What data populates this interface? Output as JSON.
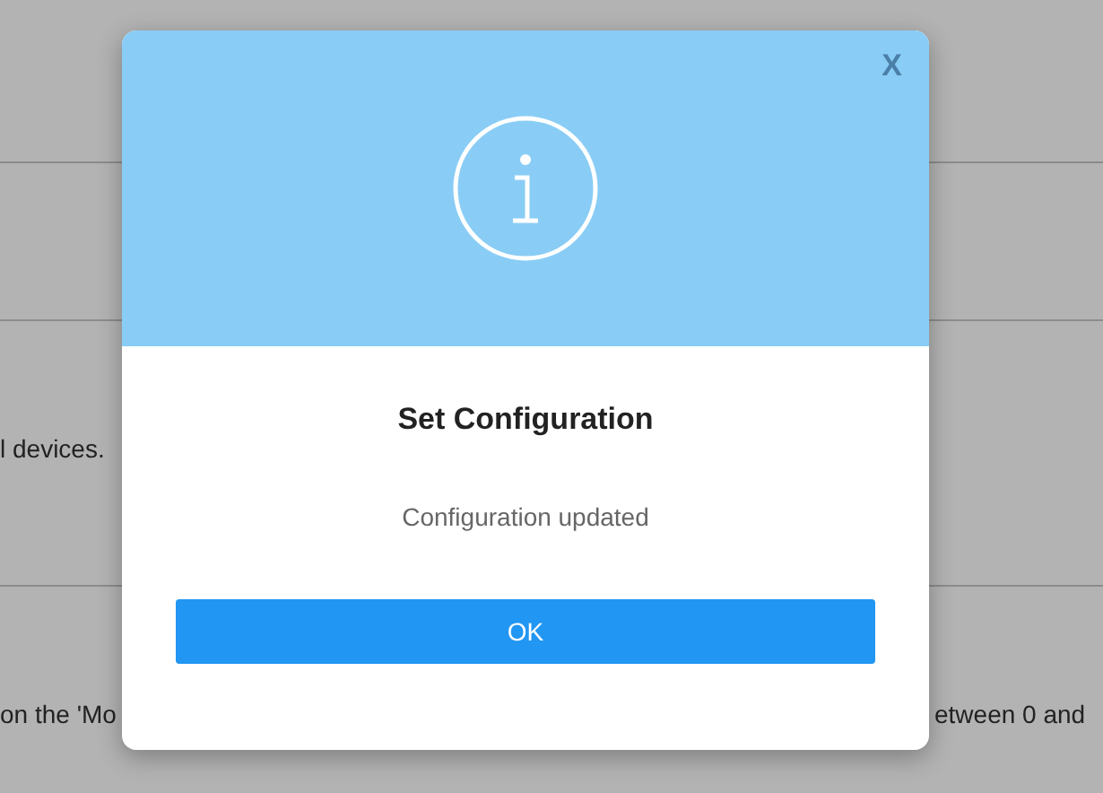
{
  "background": {
    "sections": [
      {
        "left": "l devices."
      },
      {
        "left": "on the 'Mo",
        "right": "etween 0 and"
      }
    ]
  },
  "dialog": {
    "close": "X",
    "title": "Set Configuration",
    "message": "Configuration updated",
    "button": "OK"
  }
}
